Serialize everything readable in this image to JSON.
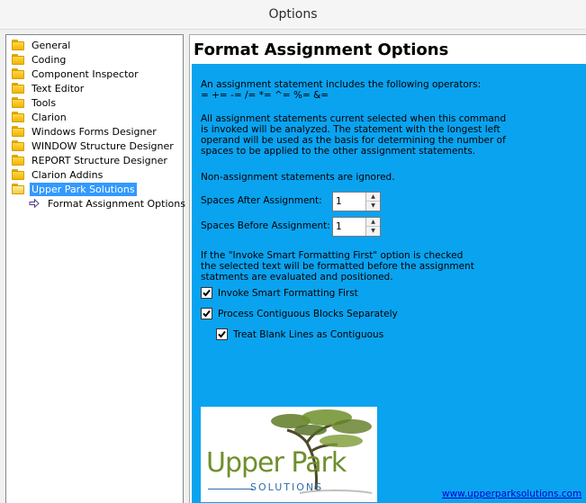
{
  "window": {
    "title": "Options"
  },
  "tree": {
    "items": [
      {
        "label": "General",
        "icon": "folder-icon"
      },
      {
        "label": "Coding",
        "icon": "folder-icon"
      },
      {
        "label": "Component Inspector",
        "icon": "folder-icon"
      },
      {
        "label": "Text Editor",
        "icon": "folder-icon"
      },
      {
        "label": "Tools",
        "icon": "folder-icon"
      },
      {
        "label": "Clarion",
        "icon": "folder-icon"
      },
      {
        "label": "Windows Forms Designer",
        "icon": "folder-icon"
      },
      {
        "label": "WINDOW Structure Designer",
        "icon": "folder-icon"
      },
      {
        "label": "REPORT Structure Designer",
        "icon": "folder-icon"
      },
      {
        "label": "Clarion Addins",
        "icon": "folder-icon"
      },
      {
        "label": "Upper Park Solutions",
        "icon": "open-folder-icon",
        "selected": true
      },
      {
        "label": "Format Assignment Options",
        "icon": "arrow-icon"
      }
    ]
  },
  "panel": {
    "title": "Format Assignment Options",
    "intro_line1": "An assignment statement includes the following operators:",
    "intro_line2": "= += -= /= *= ^= %= &=",
    "para2_line1": "All assignment statements current selected when this command",
    "para2_line2": "is invoked will be analyzed. The statement with the longest left",
    "para2_line3": "operand will be used as the basis for determining the number of",
    "para2_line4": "spaces to be applied to the other assignment statements.",
    "para3": "Non-assignment statements are ignored.",
    "spaces_after_label": "Spaces After Assignment:",
    "spaces_after_value": "1",
    "spaces_before_label": "Spaces Before Assignment:",
    "spaces_before_value": "1",
    "para4_line1": "If the \"Invoke Smart Formatting First\" option is checked",
    "para4_line2": "the selected text will be formatted before the assignment",
    "para4_line3": "statments are evaluated and positioned.",
    "checkbox_smart": "Invoke Smart Formatting First",
    "checkbox_smart_checked": true,
    "checkbox_contiguous": "Process Contiguous Blocks Separately",
    "checkbox_contiguous_checked": true,
    "checkbox_blank": "Treat Blank Lines as Contiguous",
    "checkbox_blank_checked": true,
    "logo_text": "Upper Park",
    "logo_sub": "SOLUTIONS",
    "url": "www.upperparksolutions.com"
  },
  "colors": {
    "panel_background": "#0aa3f0",
    "selection": "#3399ff",
    "logo_green": "#6f8f2c",
    "logo_blue": "#2f6da8",
    "link": "#0000cc"
  }
}
